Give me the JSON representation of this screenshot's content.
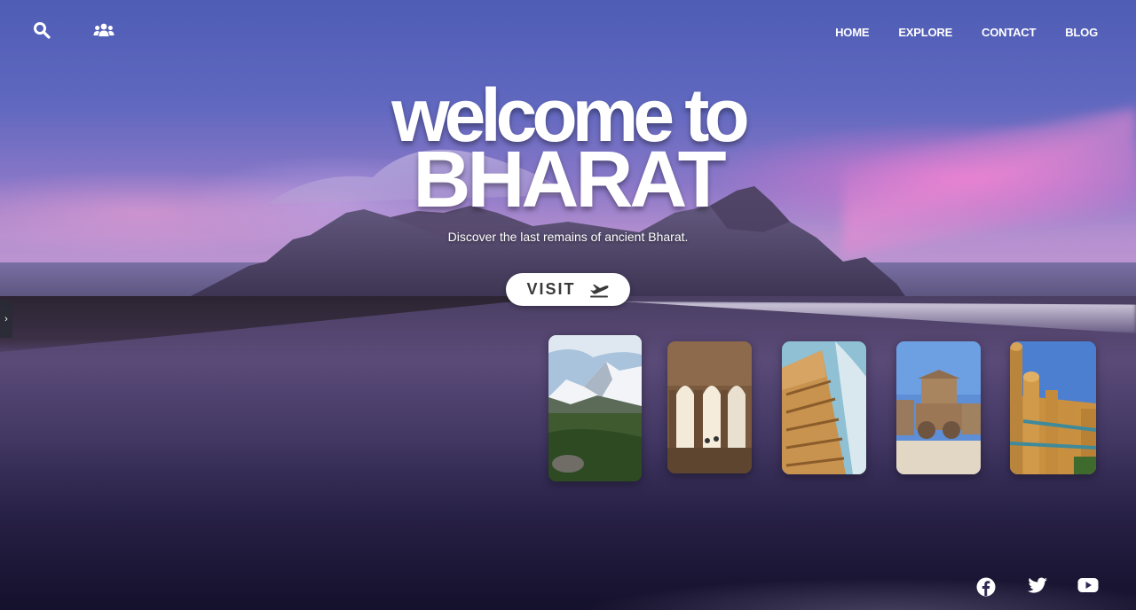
{
  "nav": {
    "links": [
      "HOME",
      "EXPLORE",
      "CONTACT",
      "BLOG"
    ]
  },
  "icons": {
    "search": "search-icon",
    "group": "users-icon",
    "visit": "plane-departure-icon",
    "side": "chevron-right-icon"
  },
  "hero": {
    "line1": "welcome to",
    "line2": "BHARAT",
    "tagline": "Discover the last remains of ancient Bharat.",
    "visit_label": "VISIT"
  },
  "side_handle": {
    "glyph": "›"
  },
  "cards": [
    {
      "name": "card-snow-mountain"
    },
    {
      "name": "card-stone-pillared-hall"
    },
    {
      "name": "card-carved-temple-tower"
    },
    {
      "name": "card-stone-chariot"
    },
    {
      "name": "card-fort-palace"
    }
  ],
  "socials": [
    "facebook-icon",
    "twitter-icon",
    "youtube-icon"
  ],
  "colors": {
    "sky_top": "#4f5db5",
    "sky_pink": "#ec78d2",
    "button_bg": "#ffffff",
    "button_text": "#3a3a3a"
  }
}
